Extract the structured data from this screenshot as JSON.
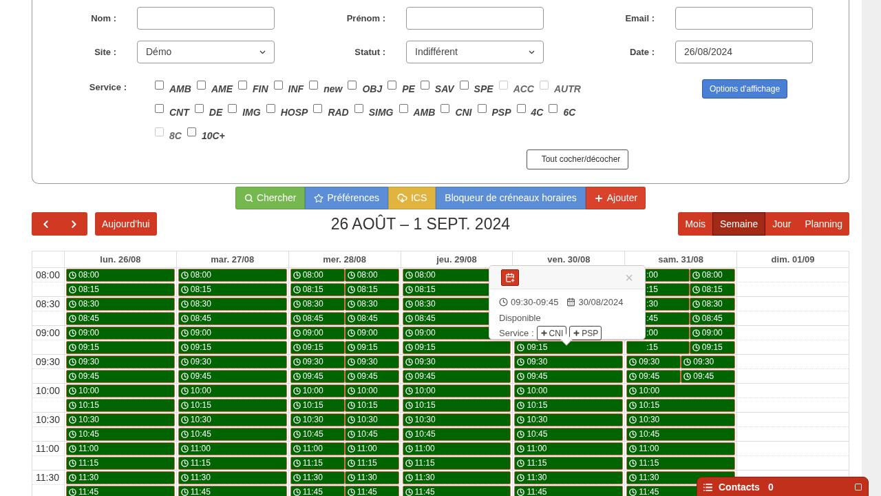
{
  "form": {
    "fields": [
      {
        "label": "Nom :",
        "kind": "text"
      },
      {
        "label": "Prénom :",
        "kind": "text"
      },
      {
        "label": "Email :",
        "kind": "text"
      },
      {
        "label": "Site :",
        "kind": "select",
        "value": "Démo"
      },
      {
        "label": "Statut :",
        "kind": "select",
        "value": "Indifférent"
      },
      {
        "label": "Date :",
        "kind": "text",
        "value": "26/08/2024"
      }
    ],
    "service_label": "Service :",
    "service_rows": [
      [
        {
          "label": "AMB",
          "checked": false,
          "disabled": false
        },
        {
          "label": "AME",
          "checked": false,
          "disabled": false
        },
        {
          "label": "FIN",
          "checked": false,
          "disabled": false
        },
        {
          "label": "INF",
          "checked": false,
          "disabled": false
        },
        {
          "label": "new",
          "checked": false,
          "disabled": false
        },
        {
          "label": "OBJ",
          "checked": false,
          "disabled": false
        },
        {
          "label": "PE",
          "checked": false,
          "disabled": false
        },
        {
          "label": "SAV",
          "checked": false,
          "disabled": false
        },
        {
          "label": "SPE",
          "checked": false,
          "disabled": false
        },
        {
          "label": "ACC",
          "checked": false,
          "disabled": true
        },
        {
          "label": "AUTR",
          "checked": false,
          "disabled": true
        }
      ],
      [
        {
          "label": "CNT",
          "checked": false,
          "disabled": false
        },
        {
          "label": "DE",
          "checked": false,
          "disabled": false
        },
        {
          "label": "IMG",
          "checked": false,
          "disabled": false
        },
        {
          "label": "HOSP",
          "checked": false,
          "disabled": false
        },
        {
          "label": "RAD",
          "checked": false,
          "disabled": false
        },
        {
          "label": "SIMG",
          "checked": false,
          "disabled": false
        },
        {
          "label": "AMB",
          "checked": false,
          "disabled": false
        },
        {
          "label": "CNI",
          "checked": false,
          "disabled": false
        },
        {
          "label": "PSP",
          "checked": false,
          "disabled": false
        },
        {
          "label": "4C",
          "checked": false,
          "disabled": false
        },
        {
          "label": "6C",
          "checked": false,
          "disabled": false
        }
      ],
      [
        {
          "label": "8C",
          "checked": false,
          "disabled": true
        },
        {
          "label": "10C+",
          "checked": false,
          "disabled": false
        }
      ]
    ],
    "options_button": "Options d'affichage",
    "toggle_all_button": "Tout cocher/décocher"
  },
  "toolbar": [
    {
      "label": "Chercher",
      "kind": "search",
      "color": "#75b84f"
    },
    {
      "label": "Préférences",
      "kind": "favorite",
      "color": "#5b8ed6"
    },
    {
      "label": "ICS",
      "kind": "export",
      "color": "#e0b43f"
    },
    {
      "label": "Bloqueur de créneaux horaires",
      "kind": "block",
      "color": "#5b8ed6"
    },
    {
      "label": "Ajouter",
      "kind": "add",
      "color": "#d9432b"
    }
  ],
  "today_button": "Aujourd'hui",
  "title": "26 AOÛT – 1 SEPT. 2024",
  "views": [
    {
      "label": "Mois",
      "selected": false
    },
    {
      "label": "Semaine",
      "selected": true
    },
    {
      "label": "Jour",
      "selected": false
    },
    {
      "label": "Planning",
      "selected": false
    }
  ],
  "calendar": {
    "time_labels": [
      "08:00",
      "08:30",
      "09:00",
      "09:30",
      "10:00",
      "10:30",
      "11:00",
      "11:30"
    ],
    "days": [
      {
        "header": "lun. 26/08",
        "rows": [
          [
            {
              "time": "08:00",
              "kind": "slot"
            }
          ],
          [
            {
              "time": "08:15",
              "kind": "slot"
            }
          ],
          [
            {
              "time": "08:30",
              "kind": "slot"
            }
          ],
          [
            {
              "time": "08:45",
              "kind": "slot"
            }
          ],
          [
            {
              "time": "09:00",
              "kind": "slot"
            }
          ],
          [
            {
              "time": "09:15",
              "kind": "slot"
            }
          ],
          [
            {
              "time": "09:30",
              "kind": "slot"
            }
          ],
          [
            {
              "time": "09:45",
              "kind": "slot"
            }
          ],
          [
            {
              "time": "10:00",
              "kind": "slot"
            }
          ],
          [
            {
              "time": "10:15",
              "kind": "slot"
            }
          ],
          [
            {
              "time": "10:30",
              "kind": "slot"
            }
          ],
          [
            {
              "time": "10:45",
              "kind": "slot"
            }
          ],
          [
            {
              "time": "11:00",
              "kind": "slot"
            }
          ],
          [
            {
              "time": "11:15",
              "kind": "slot"
            }
          ],
          [
            {
              "time": "11:30",
              "kind": "slot"
            }
          ],
          [
            {
              "time": "11:45",
              "kind": "slot"
            }
          ]
        ]
      },
      {
        "header": "mar. 27/08",
        "rows": [
          [
            {
              "time": "08:00",
              "kind": "slot"
            }
          ],
          [
            {
              "time": "08:15",
              "kind": "slot"
            }
          ],
          [
            {
              "time": "08:30",
              "kind": "slot"
            }
          ],
          [
            {
              "time": "08:45",
              "kind": "slot"
            }
          ],
          [
            {
              "time": "09:00",
              "kind": "slot"
            }
          ],
          [
            {
              "time": "09:15",
              "kind": "slot"
            }
          ],
          [
            {
              "time": "09:30",
              "kind": "slot"
            }
          ],
          [
            {
              "time": "09:45",
              "kind": "slot"
            }
          ],
          [
            {
              "time": "10:00",
              "kind": "slot"
            }
          ],
          [
            {
              "time": "10:15",
              "kind": "slot"
            }
          ],
          [
            {
              "time": "10:30",
              "kind": "slot"
            }
          ],
          [
            {
              "time": "10:45",
              "kind": "slot"
            }
          ],
          [
            {
              "time": "11:00",
              "kind": "slot"
            }
          ],
          [
            {
              "time": "11:15",
              "kind": "slot"
            }
          ],
          [
            {
              "time": "11:30",
              "kind": "slot"
            }
          ],
          [
            {
              "time": "11:45",
              "kind": "slot"
            }
          ]
        ]
      },
      {
        "header": "mer. 28/08",
        "rows": [
          [
            {
              "time": "08:00",
              "kind": "slot"
            },
            {
              "time": "08:00",
              "kind": "slot"
            }
          ],
          [
            {
              "time": "08:15",
              "kind": "slot"
            },
            {
              "time": "08:15",
              "kind": "slot"
            }
          ],
          [
            {
              "time": "08:30",
              "kind": "slot"
            },
            {
              "time": "08:30",
              "kind": "slot"
            }
          ],
          [
            {
              "time": "08:45",
              "kind": "slot"
            },
            {
              "time": "08:45",
              "kind": "slot"
            }
          ],
          [
            {
              "time": "09:00",
              "kind": "slot"
            },
            {
              "time": "09:00",
              "kind": "slot"
            }
          ],
          [
            {
              "time": "09:15",
              "kind": "slot"
            },
            {
              "time": "09:15",
              "kind": "slot"
            }
          ],
          [
            {
              "time": "09:30",
              "kind": "slot"
            },
            {
              "time": "09:30",
              "kind": "slot"
            }
          ],
          [
            {
              "time": "09:45",
              "kind": "slot"
            },
            {
              "time": "09:45",
              "kind": "slot"
            }
          ],
          [
            {
              "time": "10:00",
              "kind": "slot"
            },
            {
              "time": "10:00",
              "kind": "slot"
            }
          ],
          [
            {
              "time": "10:15",
              "kind": "slot"
            },
            {
              "time": "10:15",
              "kind": "slot"
            }
          ],
          [
            {
              "time": "10:30",
              "kind": "slot"
            },
            {
              "time": "10:30",
              "kind": "slot"
            }
          ],
          [
            {
              "time": "10:45",
              "kind": "slot"
            },
            {
              "time": "10:45",
              "kind": "slot"
            }
          ],
          [
            {
              "time": "11:00",
              "kind": "slot"
            },
            {
              "time": "11:00",
              "kind": "slot"
            }
          ],
          [
            {
              "time": "11:15",
              "kind": "slot"
            },
            {
              "time": "11:15",
              "kind": "slot"
            }
          ],
          [
            {
              "time": "11:30",
              "kind": "slot"
            },
            {
              "time": "11:30",
              "kind": "slot"
            }
          ],
          [
            {
              "time": "11:45",
              "kind": "slot"
            },
            {
              "time": "11:45",
              "kind": "slot"
            }
          ]
        ]
      },
      {
        "header": "jeu. 29/08",
        "rows": [
          [
            {
              "time": "08:00",
              "kind": "slot"
            }
          ],
          [
            {
              "time": "08:15",
              "kind": "slot"
            }
          ],
          [
            {
              "time": "08:30",
              "kind": "slot"
            }
          ],
          [
            {
              "time": "08:45",
              "kind": "slot"
            }
          ],
          [
            {
              "time": "09:00",
              "kind": "slot"
            }
          ],
          [
            {
              "time": "09:15",
              "kind": "slot"
            }
          ],
          [
            {
              "time": "09:30",
              "kind": "slot"
            }
          ],
          [
            {
              "time": "09:45",
              "kind": "slot"
            }
          ],
          [
            {
              "time": "10:00",
              "kind": "slot"
            }
          ],
          [
            {
              "time": "10:15",
              "kind": "slot"
            }
          ],
          [
            {
              "time": "10:30",
              "kind": "slot"
            }
          ],
          [
            {
              "time": "10:45",
              "kind": "slot"
            }
          ],
          [
            {
              "time": "11:00",
              "kind": "slot"
            }
          ],
          [
            {
              "time": "11:15",
              "kind": "slot"
            }
          ],
          [
            {
              "time": "11:30",
              "kind": "slot"
            }
          ],
          [
            {
              "time": "11:45",
              "kind": "slot"
            }
          ]
        ]
      },
      {
        "header": "ven. 30/08",
        "rows": [
          [],
          [],
          [],
          [],
          [],
          [
            {
              "time": "09:15",
              "kind": "slot"
            }
          ],
          [
            {
              "time": "09:30",
              "kind": "slot"
            }
          ],
          [
            {
              "time": "09:45",
              "kind": "slot"
            }
          ],
          [
            {
              "time": "10:00",
              "kind": "slot"
            }
          ],
          [
            {
              "time": "10:15",
              "kind": "slot"
            }
          ],
          [
            {
              "time": "10:30",
              "kind": "slot"
            }
          ],
          [
            {
              "time": "10:45",
              "kind": "slot"
            }
          ],
          [
            {
              "time": "11:00",
              "kind": "slot"
            }
          ],
          [
            {
              "time": "11:15",
              "kind": "slot"
            }
          ],
          [
            {
              "time": "11:30",
              "kind": "slot"
            }
          ],
          [
            {
              "time": "11:45",
              "kind": "slot"
            }
          ]
        ]
      },
      {
        "header": "sam. 31/08",
        "rows": [
          [
            {
              "time": ":00",
              "kind": "clipped"
            },
            {
              "time": "08:00",
              "kind": "slot"
            }
          ],
          [
            {
              "time": ":15",
              "kind": "clipped"
            },
            {
              "time": "08:15",
              "kind": "slot"
            }
          ],
          [
            {
              "time": ":30",
              "kind": "clipped"
            },
            {
              "time": "08:30",
              "kind": "slot"
            }
          ],
          [
            {
              "time": ":45",
              "kind": "clipped"
            },
            {
              "time": "08:45",
              "kind": "slot"
            }
          ],
          [
            {
              "time": ":00",
              "kind": "clipped"
            },
            {
              "time": "09:00",
              "kind": "slot"
            }
          ],
          [
            {
              "time": ":15",
              "kind": "clipped"
            },
            {
              "time": "09:15",
              "kind": "slot"
            }
          ],
          [
            {
              "time": "09:30",
              "kind": "slot"
            },
            {
              "time": "09:30",
              "kind": "slot"
            }
          ],
          [
            {
              "time": "09:45",
              "kind": "slot"
            },
            {
              "time": "09:45",
              "kind": "slot"
            }
          ],
          [
            {
              "time": "10:00",
              "kind": "slot"
            }
          ],
          [
            {
              "time": "10:15",
              "kind": "slot"
            }
          ],
          [
            {
              "time": "10:30",
              "kind": "slot"
            }
          ],
          [
            {
              "time": "10:45",
              "kind": "slot"
            }
          ],
          [
            {
              "time": "11:00",
              "kind": "slot"
            }
          ],
          [
            {
              "time": "11:15",
              "kind": "slot"
            }
          ],
          [
            {
              "time": "11:30",
              "kind": "slot"
            }
          ],
          [
            {
              "time": "11:45",
              "kind": "slot"
            }
          ]
        ]
      },
      {
        "header": "dim. 01/09"
      }
    ]
  },
  "popover": {
    "time_range": "09:30-09:45",
    "date": "30/08/2024",
    "status": "Disponible",
    "service_label": "Service :",
    "services": [
      "CNI",
      "PSP"
    ],
    "close": "×"
  },
  "contacts": {
    "label": "Contacts",
    "count": "0"
  }
}
